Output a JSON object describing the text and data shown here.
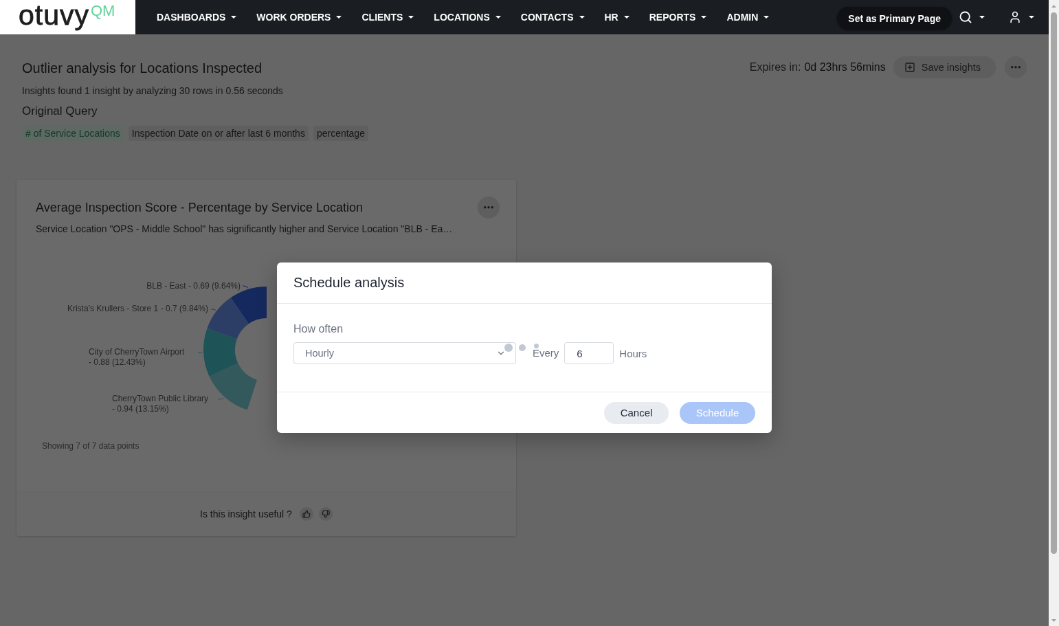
{
  "logo": {
    "wordmark": "otuvy",
    "suffix": "QM"
  },
  "nav": {
    "items": [
      {
        "label": "DASHBOARDS"
      },
      {
        "label": "WORK ORDERS"
      },
      {
        "label": "CLIENTS"
      },
      {
        "label": "LOCATIONS"
      },
      {
        "label": "CONTACTS"
      },
      {
        "label": "HR"
      },
      {
        "label": "REPORTS"
      },
      {
        "label": "ADMIN"
      }
    ],
    "primary_page_button": "Set as Primary Page"
  },
  "page_header": {
    "title": "Outlier analysis for Locations Inspected",
    "summary": "Insights found 1 insight by analyzing 30 rows in 0.56 seconds",
    "query_heading": "Original Query",
    "query_terms": [
      {
        "text": "# of Service Locations",
        "kind": "measure"
      },
      {
        "text": "Inspection Date on or after last 6 months",
        "kind": "filter"
      },
      {
        "text": "percentage",
        "kind": "filter"
      }
    ],
    "expires_label": "Expires in:",
    "expires_value": "0d 23hrs 56mins",
    "save_button": "Save insights"
  },
  "insight_card": {
    "title": "Average Inspection Score - Percentage by Service Location",
    "description": "Service Location \"OPS - Middle School\" has significantly higher and Service Location \"BLB - Ea…",
    "chart_data": {
      "type": "donut",
      "categories": [
        "BLB - East",
        "Krista's Krullers - Store 1",
        "City of CherryTown Airport",
        "CherryTown Public Library"
      ],
      "values": [
        9.64,
        9.84,
        12.43,
        13.15
      ],
      "value_labels": [
        "- 0.69 (9.64%)",
        "- 0.7 (9.84%)",
        "- 0.88 (12.43%)",
        "- 0.94 (13.15%)"
      ],
      "colors": [
        "#15295e",
        "#2c3d66",
        "#1e5357",
        "#34595c"
      ]
    },
    "footnote": "Showing 7 of 7 data points"
  },
  "feedback": {
    "question": "Is this insight useful ?"
  },
  "dialog": {
    "title": "Schedule analysis",
    "frequency_label": "How often",
    "frequency": {
      "value": "Hourly"
    },
    "loading": true,
    "every_label": "Every",
    "interval": {
      "value": "6"
    },
    "unit_label": "Hours",
    "buttons": [
      {
        "label": "Cancel",
        "kind": "secondary",
        "disabled": false
      },
      {
        "label": "Schedule",
        "kind": "primary",
        "disabled": true
      }
    ]
  }
}
